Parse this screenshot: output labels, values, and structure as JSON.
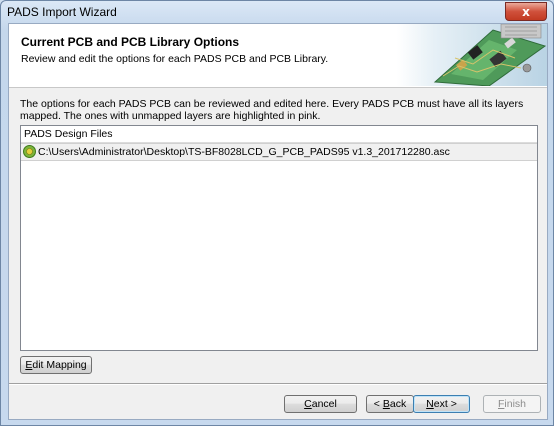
{
  "window": {
    "title": "PADS Import Wizard",
    "close_glyph": "x"
  },
  "header": {
    "title": "Current PCB and PCB Library Options",
    "subtitle": "Review and edit the options for each PADS PCB and PCB Library.",
    "art_icon": "pcb-board-illustration"
  },
  "description": "The options for each PADS PCB can be reviewed and edited here. Every PADS PCB must have all its layers mapped. The ones with unmapped layers are highlighted in pink.",
  "file_list": {
    "column_header": "PADS Design Files",
    "rows": [
      {
        "icon": "pads-pcb-icon",
        "path": "C:\\Users\\Administrator\\Desktop\\TS-BF8028LCD_G_PCB_PADS95 v1.3_201712280.asc"
      }
    ]
  },
  "buttons": {
    "edit_mapping": {
      "accel": "E",
      "rest": "dit Mapping"
    },
    "cancel": {
      "accel": "C",
      "rest": "ancel"
    },
    "back": {
      "prefix": "< ",
      "accel": "B",
      "rest": "ack"
    },
    "next": {
      "accel": "N",
      "rest": "ext >"
    },
    "finish": {
      "accel": "F",
      "rest": "inish"
    }
  },
  "colors": {
    "accent_border": "#3c7fb1",
    "close_red": "#c23a22"
  }
}
